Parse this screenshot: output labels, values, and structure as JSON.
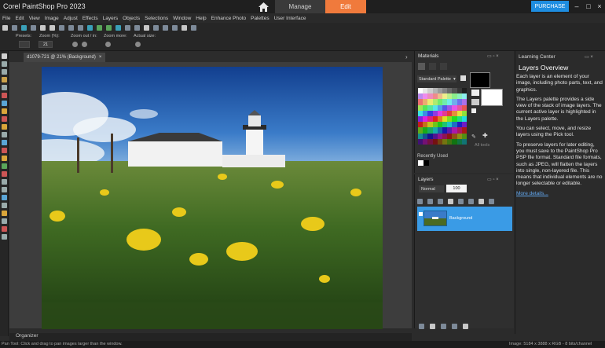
{
  "app": {
    "title": "Corel PaintShop Pro 2023",
    "tabs": {
      "manage": "Manage",
      "edit": "Edit"
    },
    "purchase_label": "PURCHASE",
    "accent_color": "#f07a3c",
    "purchase_color": "#1e8de0"
  },
  "menu": [
    "File",
    "Edit",
    "View",
    "Image",
    "Adjust",
    "Effects",
    "Layers",
    "Objects",
    "Selections",
    "Window",
    "Help",
    "Enhance Photo",
    "Palettes",
    "User Interface"
  ],
  "tool_options": {
    "presets_label": "Presets:",
    "zoom_label": "Zoom (%):",
    "zoom_value": "21",
    "zoom_out_in_label": "Zoom out / in:",
    "zoom_more_label": "Zoom more:",
    "actual_size_label": "Actual size:"
  },
  "document": {
    "tab_label": "d1079-721 @ 21% (Background)",
    "close_icon": "×"
  },
  "materials": {
    "title": "Materials",
    "palette_select": "Standard Palette",
    "recently_used": "Recently Used",
    "all_tools": "All tools"
  },
  "layers": {
    "title": "Layers",
    "blend_mode": "Normal",
    "opacity": "100",
    "layer_name": "Background",
    "selected_color": "#3a9be6"
  },
  "learning_center": {
    "title": "Learning Center",
    "heading": "Layers Overview",
    "paragraphs": [
      "Each layer is an element of your image, including photo parts, text, and graphics.",
      "The Layers palette provides a side view of the stack of image layers. The current active layer is highlighted in the Layers palette.",
      "You can select, move, and resize layers using the Pick tool.",
      "To preserve layers for later editing, you must save to the PaintShop Pro PSP file format. Standard file formats, such as JPEG, will flatten the layers into single, non-layered file. This means that individual elements are no longer selectable or editable."
    ],
    "more_link": "More details..."
  },
  "organizer": {
    "label": "Organizer"
  },
  "status": {
    "left": "Pan Tool: Click and drag to pan images larger than the window.",
    "right": "Image: 5184 x 3888 x RGB - 8 bits/channel"
  }
}
